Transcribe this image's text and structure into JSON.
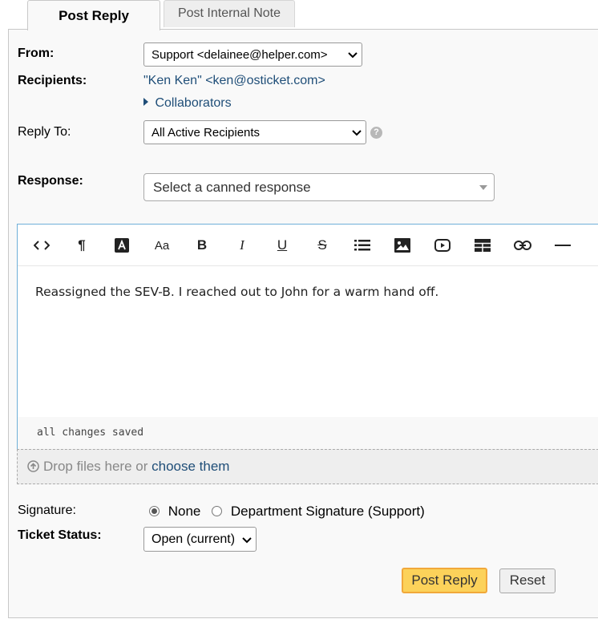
{
  "tabs": {
    "post_reply": "Post Reply",
    "post_internal_note": "Post Internal Note"
  },
  "form": {
    "from_label": "From:",
    "from_value": "Support <delainee@helper.com>",
    "recipients_label": "Recipients:",
    "recipients_value": "\"Ken Ken\" <ken@osticket.com>",
    "collaborators_label": "Collaborators",
    "reply_to_label": "Reply To:",
    "reply_to_value": "All Active Recipients",
    "response_label": "Response:",
    "canned_placeholder": "Select a canned response"
  },
  "toolbar": {
    "icons": [
      "code-view-icon",
      "paragraph-icon",
      "text-color-icon",
      "font-size-icon",
      "bold-icon",
      "italic-icon",
      "underline-icon",
      "strikethrough-icon",
      "list-icon",
      "image-icon",
      "video-icon",
      "table-icon",
      "link-icon",
      "horizontal-rule-icon"
    ],
    "paragraph": "¶",
    "font_size": "Aa",
    "bold": "B",
    "italic": "I",
    "underline": "U",
    "strike": "S"
  },
  "editor": {
    "text": "Reassigned the SEV-B. I reached out to John for a warm hand off.",
    "status": "all changes saved"
  },
  "attachments": {
    "prefix": "Drop files here or ",
    "link": "choose them"
  },
  "signature": {
    "label": "Signature:",
    "option_none": "None",
    "option_dept": "Department Signature (Support)",
    "selected": "None"
  },
  "status": {
    "label": "Ticket Status:",
    "value": "Open (current)"
  },
  "buttons": {
    "post_reply": "Post Reply",
    "reset": "Reset"
  },
  "colors": {
    "link": "#1f4e78",
    "primary_button": "#fcd25a",
    "primary_border": "#f1a83b",
    "editor_border": "#6fb0d8"
  }
}
